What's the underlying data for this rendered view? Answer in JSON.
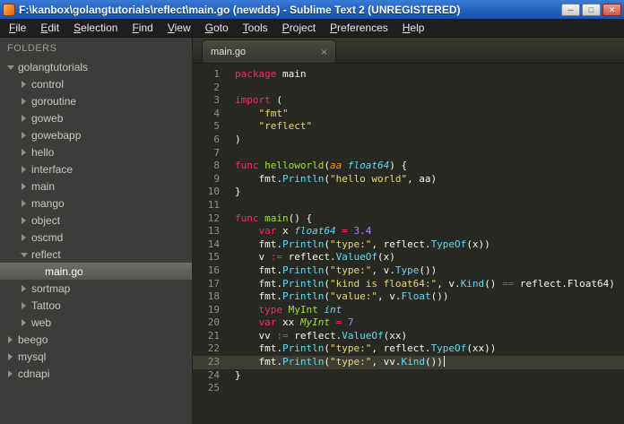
{
  "window": {
    "title": "F:\\kanbox\\golangtutorials\\reflect\\main.go (newdds) - Sublime Text 2 (UNREGISTERED)",
    "controls": {
      "minimize": "─",
      "maximize": "□",
      "close": "✕"
    }
  },
  "menu": {
    "items": [
      "File",
      "Edit",
      "Selection",
      "Find",
      "View",
      "Goto",
      "Tools",
      "Project",
      "Preferences",
      "Help"
    ]
  },
  "sidebar": {
    "header": "FOLDERS",
    "items": [
      {
        "label": "golangtutorials",
        "level": 0,
        "type": "folder",
        "state": "expanded"
      },
      {
        "label": "control",
        "level": 1,
        "type": "folder",
        "state": "collapsed"
      },
      {
        "label": "goroutine",
        "level": 1,
        "type": "folder",
        "state": "collapsed"
      },
      {
        "label": "goweb",
        "level": 1,
        "type": "folder",
        "state": "collapsed"
      },
      {
        "label": "gowebapp",
        "level": 1,
        "type": "folder",
        "state": "collapsed"
      },
      {
        "label": "hello",
        "level": 1,
        "type": "folder",
        "state": "collapsed"
      },
      {
        "label": "interface",
        "level": 1,
        "type": "folder",
        "state": "collapsed"
      },
      {
        "label": "main",
        "level": 1,
        "type": "folder",
        "state": "collapsed"
      },
      {
        "label": "mango",
        "level": 1,
        "type": "folder",
        "state": "collapsed"
      },
      {
        "label": "object",
        "level": 1,
        "type": "folder",
        "state": "collapsed"
      },
      {
        "label": "oscmd",
        "level": 1,
        "type": "folder",
        "state": "collapsed"
      },
      {
        "label": "reflect",
        "level": 1,
        "type": "folder",
        "state": "expanded"
      },
      {
        "label": "main.go",
        "level": 2,
        "type": "file",
        "selected": true
      },
      {
        "label": "sortmap",
        "level": 1,
        "type": "folder",
        "state": "collapsed"
      },
      {
        "label": "Tattoo",
        "level": 1,
        "type": "folder",
        "state": "collapsed"
      },
      {
        "label": "web",
        "level": 1,
        "type": "folder",
        "state": "collapsed"
      },
      {
        "label": "beego",
        "level": 0,
        "type": "folder",
        "state": "collapsed"
      },
      {
        "label": "mysql",
        "level": 0,
        "type": "folder",
        "state": "collapsed"
      },
      {
        "label": "cdnapi",
        "level": 0,
        "type": "folder",
        "state": "collapsed"
      }
    ]
  },
  "tabbar": {
    "tabs": [
      {
        "label": "main.go",
        "close": "×",
        "active": true
      }
    ]
  },
  "editor": {
    "current_line": 23,
    "caret_line": 23,
    "lines": [
      {
        "n": 1,
        "t": [
          [
            "kw",
            "package"
          ],
          [
            "pl",
            " main"
          ]
        ]
      },
      {
        "n": 2,
        "t": []
      },
      {
        "n": 3,
        "t": [
          [
            "kw",
            "import"
          ],
          [
            "pl",
            " ("
          ]
        ]
      },
      {
        "n": 4,
        "t": [
          [
            "pl",
            "    "
          ],
          [
            "str",
            "\"fmt\""
          ]
        ]
      },
      {
        "n": 5,
        "t": [
          [
            "pl",
            "    "
          ],
          [
            "str",
            "\"reflect\""
          ]
        ]
      },
      {
        "n": 6,
        "t": [
          [
            "pl",
            ")"
          ]
        ]
      },
      {
        "n": 7,
        "t": []
      },
      {
        "n": 8,
        "t": [
          [
            "kw",
            "func"
          ],
          [
            "pl",
            " "
          ],
          [
            "fn",
            "helloworld"
          ],
          [
            "pl",
            "("
          ],
          [
            "param",
            "aa"
          ],
          [
            "pl",
            " "
          ],
          [
            "type",
            "float64"
          ],
          [
            "pl",
            ") {"
          ]
        ]
      },
      {
        "n": 9,
        "t": [
          [
            "pl",
            "    fmt."
          ],
          [
            "call",
            "Println"
          ],
          [
            "pl",
            "("
          ],
          [
            "str",
            "\"hello world\""
          ],
          [
            "pl",
            ", aa)"
          ]
        ]
      },
      {
        "n": 10,
        "t": [
          [
            "pl",
            "}"
          ]
        ]
      },
      {
        "n": 11,
        "t": []
      },
      {
        "n": 12,
        "t": [
          [
            "kw",
            "func"
          ],
          [
            "pl",
            " "
          ],
          [
            "fn",
            "main"
          ],
          [
            "pl",
            "() {"
          ]
        ]
      },
      {
        "n": 13,
        "t": [
          [
            "pl",
            "    "
          ],
          [
            "kw",
            "var"
          ],
          [
            "pl",
            " x "
          ],
          [
            "type",
            "float64"
          ],
          [
            "pl",
            " "
          ],
          [
            "op",
            "="
          ],
          [
            "pl",
            " "
          ],
          [
            "num",
            "3.4"
          ]
        ]
      },
      {
        "n": 14,
        "t": [
          [
            "pl",
            "    fmt."
          ],
          [
            "call",
            "Println"
          ],
          [
            "pl",
            "("
          ],
          [
            "str",
            "\"type:\""
          ],
          [
            "pl",
            ", reflect."
          ],
          [
            "call",
            "TypeOf"
          ],
          [
            "pl",
            "(x))"
          ]
        ]
      },
      {
        "n": 15,
        "t": [
          [
            "pl",
            "    v "
          ],
          [
            "op",
            ":="
          ],
          [
            "pl",
            " reflect."
          ],
          [
            "call",
            "ValueOf"
          ],
          [
            "pl",
            "(x)"
          ]
        ]
      },
      {
        "n": 16,
        "t": [
          [
            "pl",
            "    fmt."
          ],
          [
            "call",
            "Println"
          ],
          [
            "pl",
            "("
          ],
          [
            "str",
            "\"type:\""
          ],
          [
            "pl",
            ", v."
          ],
          [
            "call",
            "Type"
          ],
          [
            "pl",
            "())"
          ]
        ]
      },
      {
        "n": 17,
        "t": [
          [
            "pl",
            "    fmt."
          ],
          [
            "call",
            "Println"
          ],
          [
            "pl",
            "("
          ],
          [
            "str",
            "\"kind is float64:\""
          ],
          [
            "pl",
            ", v."
          ],
          [
            "call",
            "Kind"
          ],
          [
            "pl",
            "() "
          ],
          [
            "op",
            "=="
          ],
          [
            "pl",
            " reflect.Float64)"
          ]
        ]
      },
      {
        "n": 18,
        "t": [
          [
            "pl",
            "    fmt."
          ],
          [
            "call",
            "Println"
          ],
          [
            "pl",
            "("
          ],
          [
            "str",
            "\"value:\""
          ],
          [
            "pl",
            ", v."
          ],
          [
            "call",
            "Float"
          ],
          [
            "pl",
            "())"
          ]
        ]
      },
      {
        "n": 19,
        "t": [
          [
            "pl",
            "    "
          ],
          [
            "kw",
            "type"
          ],
          [
            "pl",
            " "
          ],
          [
            "fn",
            "MyInt"
          ],
          [
            "pl",
            " "
          ],
          [
            "type",
            "int"
          ]
        ]
      },
      {
        "n": 20,
        "t": [
          [
            "pl",
            "    "
          ],
          [
            "kw",
            "var"
          ],
          [
            "pl",
            " xx "
          ],
          [
            "typ2",
            "MyInt"
          ],
          [
            "pl",
            " "
          ],
          [
            "op",
            "="
          ],
          [
            "pl",
            " "
          ],
          [
            "num",
            "7"
          ]
        ]
      },
      {
        "n": 21,
        "t": [
          [
            "pl",
            "    vv "
          ],
          [
            "op",
            ":="
          ],
          [
            "pl",
            " reflect."
          ],
          [
            "call",
            "ValueOf"
          ],
          [
            "pl",
            "(xx)"
          ]
        ]
      },
      {
        "n": 22,
        "t": [
          [
            "pl",
            "    fmt."
          ],
          [
            "call",
            "Println"
          ],
          [
            "pl",
            "("
          ],
          [
            "str",
            "\"type:\""
          ],
          [
            "pl",
            ", reflect."
          ],
          [
            "call",
            "TypeOf"
          ],
          [
            "pl",
            "(xx))"
          ]
        ]
      },
      {
        "n": 23,
        "t": [
          [
            "pl",
            "    fmt."
          ],
          [
            "call",
            "Println"
          ],
          [
            "pl",
            "("
          ],
          [
            "str",
            "\"type:\""
          ],
          [
            "pl",
            ", vv."
          ],
          [
            "call",
            "Kind"
          ],
          [
            "pl",
            "())"
          ]
        ]
      },
      {
        "n": 24,
        "t": [
          [
            "pl",
            "}"
          ]
        ]
      },
      {
        "n": 25,
        "t": []
      }
    ]
  },
  "colors": {
    "editor_bg": "#272822",
    "current_line_bg": "#3e3d32",
    "keyword": "#f92672",
    "string": "#e6db74",
    "number": "#ae81ff",
    "type": "#66d9ef",
    "function": "#a6e22e",
    "parameter": "#fd971f",
    "titlebar_blue": "#2160bd",
    "sidebar_bg": "#3c3c3a"
  }
}
